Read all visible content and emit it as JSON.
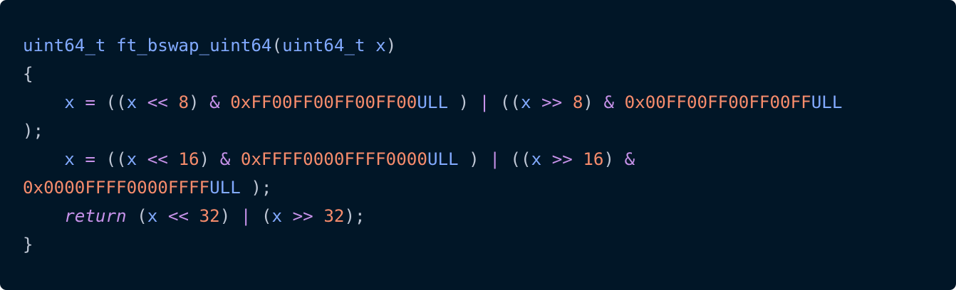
{
  "colors": {
    "background": "#011627",
    "type": "#82aaff",
    "punctuation": "#bfc7d5",
    "operator": "#c792ea",
    "number": "#f78c6c",
    "keyword": "#c792ea"
  },
  "code": {
    "language": "c",
    "lines": [
      [
        {
          "t": "uint64_t",
          "k": "type"
        },
        {
          "t": " ",
          "k": "punc"
        },
        {
          "t": "ft_bswap_uint64",
          "k": "fn"
        },
        {
          "t": "(",
          "k": "punc"
        },
        {
          "t": "uint64_t",
          "k": "type"
        },
        {
          "t": " ",
          "k": "punc"
        },
        {
          "t": "x",
          "k": "var"
        },
        {
          "t": ")",
          "k": "punc"
        }
      ],
      [
        {
          "t": "{",
          "k": "punc"
        }
      ],
      [
        {
          "t": "    ",
          "k": "punc"
        },
        {
          "t": "x",
          "k": "var"
        },
        {
          "t": " ",
          "k": "punc"
        },
        {
          "t": "=",
          "k": "op"
        },
        {
          "t": " ((",
          "k": "punc"
        },
        {
          "t": "x",
          "k": "var"
        },
        {
          "t": " ",
          "k": "punc"
        },
        {
          "t": "<<",
          "k": "op"
        },
        {
          "t": " ",
          "k": "punc"
        },
        {
          "t": "8",
          "k": "num"
        },
        {
          "t": ") ",
          "k": "punc"
        },
        {
          "t": "&",
          "k": "op"
        },
        {
          "t": " ",
          "k": "punc"
        },
        {
          "t": "0xFF00FF00FF00FF00",
          "k": "num"
        },
        {
          "t": "ULL",
          "k": "suffix"
        },
        {
          "t": " ) ",
          "k": "punc"
        },
        {
          "t": "|",
          "k": "op"
        },
        {
          "t": " ((",
          "k": "punc"
        },
        {
          "t": "x",
          "k": "var"
        },
        {
          "t": " ",
          "k": "punc"
        },
        {
          "t": ">>",
          "k": "op"
        },
        {
          "t": " ",
          "k": "punc"
        },
        {
          "t": "8",
          "k": "num"
        },
        {
          "t": ") ",
          "k": "punc"
        },
        {
          "t": "&",
          "k": "op"
        },
        {
          "t": " ",
          "k": "punc"
        },
        {
          "t": "0x00FF00FF00FF00FF",
          "k": "num"
        },
        {
          "t": "ULL",
          "k": "suffix"
        }
      ],
      [
        {
          "t": ");",
          "k": "punc"
        }
      ],
      [
        {
          "t": "    ",
          "k": "punc"
        },
        {
          "t": "x",
          "k": "var"
        },
        {
          "t": " ",
          "k": "punc"
        },
        {
          "t": "=",
          "k": "op"
        },
        {
          "t": " ((",
          "k": "punc"
        },
        {
          "t": "x",
          "k": "var"
        },
        {
          "t": " ",
          "k": "punc"
        },
        {
          "t": "<<",
          "k": "op"
        },
        {
          "t": " ",
          "k": "punc"
        },
        {
          "t": "16",
          "k": "num"
        },
        {
          "t": ") ",
          "k": "punc"
        },
        {
          "t": "&",
          "k": "op"
        },
        {
          "t": " ",
          "k": "punc"
        },
        {
          "t": "0xFFFF0000FFFF0000",
          "k": "num"
        },
        {
          "t": "ULL",
          "k": "suffix"
        },
        {
          "t": " ) ",
          "k": "punc"
        },
        {
          "t": "|",
          "k": "op"
        },
        {
          "t": " ((",
          "k": "punc"
        },
        {
          "t": "x",
          "k": "var"
        },
        {
          "t": " ",
          "k": "punc"
        },
        {
          "t": ">>",
          "k": "op"
        },
        {
          "t": " ",
          "k": "punc"
        },
        {
          "t": "16",
          "k": "num"
        },
        {
          "t": ") ",
          "k": "punc"
        },
        {
          "t": "&",
          "k": "op"
        }
      ],
      [
        {
          "t": "0x0000FFFF0000FFFF",
          "k": "num"
        },
        {
          "t": "ULL",
          "k": "suffix"
        },
        {
          "t": " );",
          "k": "punc"
        }
      ],
      [
        {
          "t": "    ",
          "k": "punc"
        },
        {
          "t": "return",
          "k": "kw"
        },
        {
          "t": " (",
          "k": "punc"
        },
        {
          "t": "x",
          "k": "var"
        },
        {
          "t": " ",
          "k": "punc"
        },
        {
          "t": "<<",
          "k": "op"
        },
        {
          "t": " ",
          "k": "punc"
        },
        {
          "t": "32",
          "k": "num"
        },
        {
          "t": ") ",
          "k": "punc"
        },
        {
          "t": "|",
          "k": "op"
        },
        {
          "t": " (",
          "k": "punc"
        },
        {
          "t": "x",
          "k": "var"
        },
        {
          "t": " ",
          "k": "punc"
        },
        {
          "t": ">>",
          "k": "op"
        },
        {
          "t": " ",
          "k": "punc"
        },
        {
          "t": "32",
          "k": "num"
        },
        {
          "t": ");",
          "k": "punc"
        }
      ],
      [
        {
          "t": "}",
          "k": "punc"
        }
      ]
    ]
  }
}
